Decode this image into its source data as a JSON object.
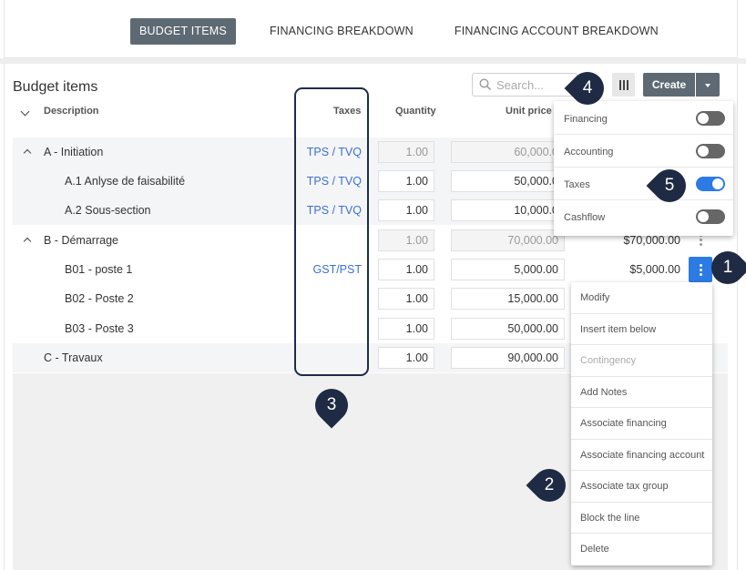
{
  "tabs": [
    {
      "label": "BUDGET ITEMS",
      "active": true
    },
    {
      "label": "FINANCING BREAKDOWN",
      "active": false
    },
    {
      "label": "FINANCING ACCOUNT BREAKDOWN",
      "active": false
    }
  ],
  "page_title": "Budget items",
  "search": {
    "placeholder": "Search..."
  },
  "toolbar": {
    "create_label": "Create"
  },
  "columns": {
    "description": "Description",
    "taxes": "Taxes",
    "quantity": "Quantity",
    "unit_price": "Unit price"
  },
  "rows": [
    {
      "description": "A - Initiation",
      "taxes": "TPS / TVQ",
      "quantity": "1.00",
      "unit_price": "60,000.0",
      "total": ""
    },
    {
      "description": "A.1 Anlyse de faisabilité",
      "taxes": "TPS / TVQ",
      "quantity": "1.00",
      "unit_price": "50,000.0",
      "total": ""
    },
    {
      "description": "A.2 Sous-section",
      "taxes": "TPS / TVQ",
      "quantity": "1.00",
      "unit_price": "10,000.0",
      "total": ""
    },
    {
      "description": "B - Démarrage",
      "taxes": "",
      "quantity": "1.00",
      "unit_price": "70,000.00",
      "total": "$70,000.00"
    },
    {
      "description": "B01 - poste 1",
      "taxes": "GST/PST",
      "quantity": "1.00",
      "unit_price": "5,000.00",
      "total": "$5,000.00"
    },
    {
      "description": "B02 - Poste 2",
      "taxes": "",
      "quantity": "1.00",
      "unit_price": "15,000.00",
      "total": ""
    },
    {
      "description": "B03 - Poste 3",
      "taxes": "",
      "quantity": "1.00",
      "unit_price": "50,000.00",
      "total": ""
    },
    {
      "description": "C - Travaux",
      "taxes": "",
      "quantity": "1.00",
      "unit_price": "90,000.00",
      "total": ""
    }
  ],
  "column_toggles": [
    {
      "label": "Financing",
      "on": false
    },
    {
      "label": "Accounting",
      "on": false
    },
    {
      "label": "Taxes",
      "on": true
    },
    {
      "label": "Cashflow",
      "on": false
    }
  ],
  "action_menu": [
    {
      "label": "Modify",
      "disabled": false
    },
    {
      "label": "Insert item below",
      "disabled": false
    },
    {
      "label": "Contingency",
      "disabled": true
    },
    {
      "label": "Add Notes",
      "disabled": false
    },
    {
      "label": "Associate financing",
      "disabled": false
    },
    {
      "label": "Associate financing account",
      "disabled": false
    },
    {
      "label": "Associate tax group",
      "disabled": false
    },
    {
      "label": "Block the line",
      "disabled": false
    },
    {
      "label": "Delete",
      "disabled": false
    }
  ],
  "markers": [
    "1",
    "2",
    "3",
    "4",
    "5"
  ],
  "colors": {
    "accent": "#2c7be5",
    "tab_active": "#5e6a73",
    "marker": "#1f2a44",
    "tax_link": "#3d6fd6"
  }
}
